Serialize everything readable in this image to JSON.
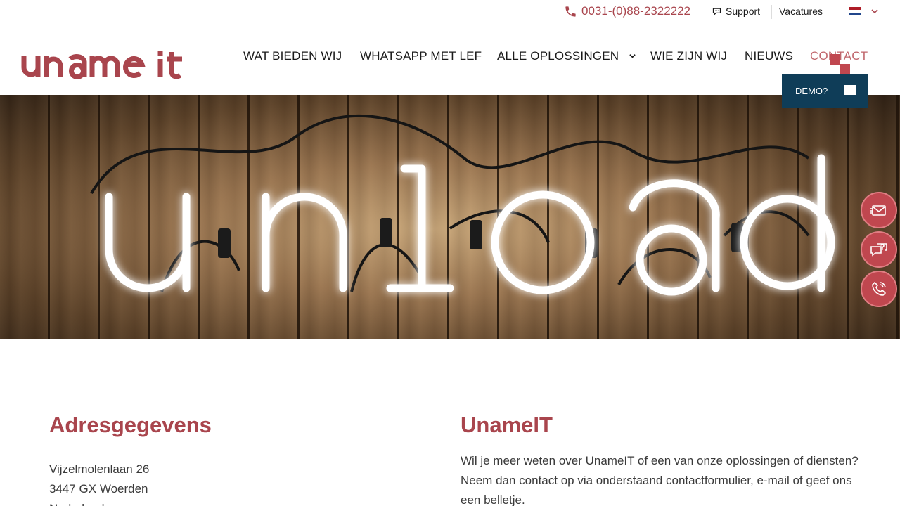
{
  "topbar": {
    "phone": "0031-(0)88-2322222",
    "support": "Support",
    "vacatures": "Vacatures",
    "language": {
      "flag_colors": [
        "#ae1c28",
        "#ffffff",
        "#21468b"
      ]
    }
  },
  "brand": {
    "logo_text": "uname it",
    "logo_color": "#a9454d"
  },
  "nav": {
    "items": [
      {
        "label": "WAT BIEDEN WIJ"
      },
      {
        "label": "WHATSAPP MET LEF"
      },
      {
        "label": "ALLE OPLOSSINGEN"
      },
      {
        "label": "WIE ZIJN WIJ"
      },
      {
        "label": "NIEUWS"
      },
      {
        "label": "CONTACT"
      }
    ],
    "active": "CONTACT",
    "demo_label": "DEMO?"
  },
  "hero": {
    "neon_text": "unload"
  },
  "side_actions": [
    "mail-icon",
    "chat-question-icon",
    "phone-icon"
  ],
  "address": {
    "title": "Adresgegevens",
    "lines": [
      "Vijzelmolenlaan 26",
      "3447 GX Woerden",
      "Nederland"
    ]
  },
  "company": {
    "title": "UnameIT",
    "intro": "Wil je meer weten over UnameIT of een van onze oplossingen of diensten? Neem dan contact op via onderstaand contactformulier, e-mail of geef ons een belletje."
  },
  "colors": {
    "accent": "#a9454d",
    "demo_bg": "#0f3d58",
    "side_button": "#c0474f"
  }
}
